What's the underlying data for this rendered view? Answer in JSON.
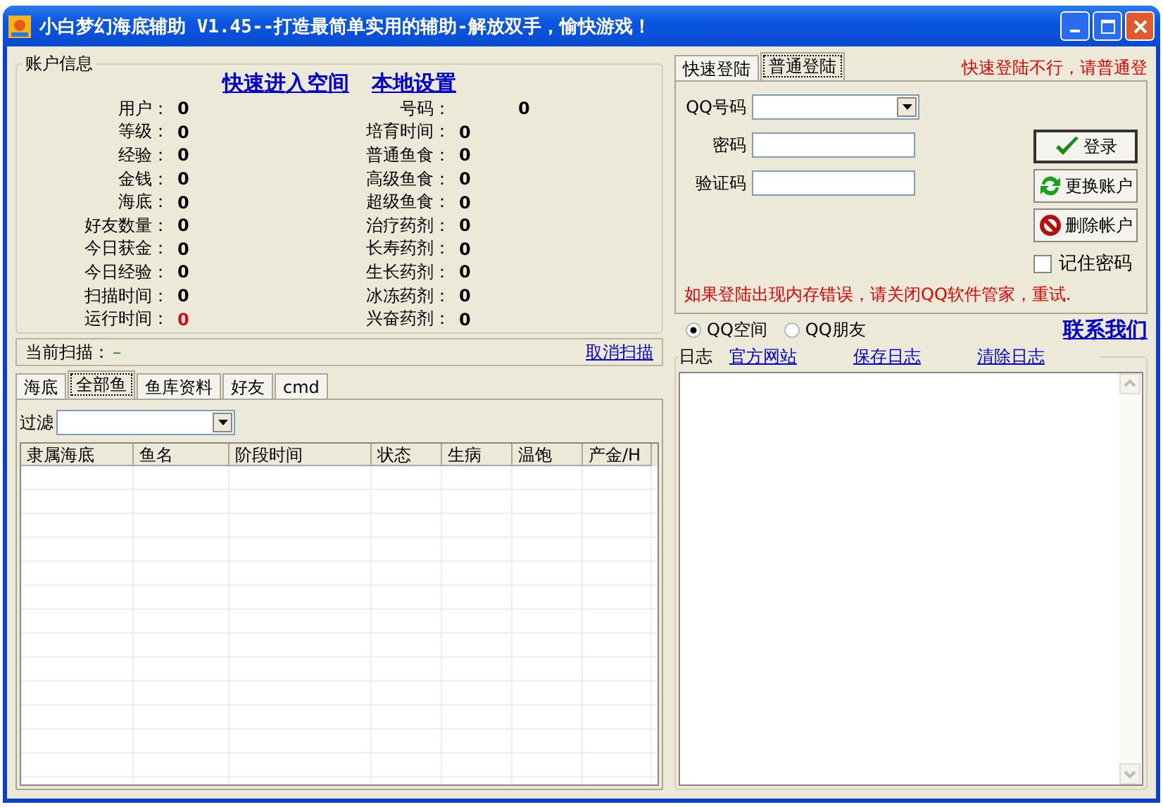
{
  "window": {
    "title": "小白梦幻海底辅助 V1.45--打造最简单实用的辅助-解放双手，愉快游戏！"
  },
  "account": {
    "title": "账户信息",
    "links": [
      "快速进入空间",
      "本地设置"
    ],
    "left_stats": [
      {
        "label": "用户：",
        "value": "0",
        "alert": false
      },
      {
        "label": "等级：",
        "value": "0",
        "alert": false
      },
      {
        "label": "经验：",
        "value": "0",
        "alert": false
      },
      {
        "label": "金钱：",
        "value": "0",
        "alert": false
      },
      {
        "label": "海底：",
        "value": "0",
        "alert": false
      },
      {
        "label": "好友数量：",
        "value": "0",
        "alert": false
      },
      {
        "label": "今日获金：",
        "value": "0",
        "alert": false
      },
      {
        "label": "今日经验：",
        "value": "0",
        "alert": false
      },
      {
        "label": "扫描时间：",
        "value": "0",
        "alert": false
      },
      {
        "label": "运行时间：",
        "value": "0",
        "alert": true
      }
    ],
    "right_stats": [
      {
        "label": "号码：",
        "value": "0",
        "kind": "wide"
      },
      {
        "label": "培育时间：",
        "value": "0",
        "kind": "normal"
      },
      {
        "label": "普通鱼食：",
        "value": "0",
        "kind": "normal"
      },
      {
        "label": "高级鱼食：",
        "value": "0",
        "kind": "normal"
      },
      {
        "label": "超级鱼食：",
        "value": "0",
        "kind": "normal"
      },
      {
        "label": "治疗药剂：",
        "value": "0",
        "kind": "normal"
      },
      {
        "label": "长寿药剂：",
        "value": "0",
        "kind": "normal"
      },
      {
        "label": "生长药剂：",
        "value": "0",
        "kind": "normal"
      },
      {
        "label": "冰冻药剂：",
        "value": "0",
        "kind": "normal"
      },
      {
        "label": "兴奋药剂：",
        "value": "0",
        "kind": "normal"
      }
    ]
  },
  "scan": {
    "label": "当前扫描：",
    "value": "–",
    "cancel": "取消扫描"
  },
  "fish_tabs": [
    {
      "label": "海底",
      "selected": false
    },
    {
      "label": "全部鱼",
      "selected": true
    },
    {
      "label": "鱼库资料",
      "selected": false
    },
    {
      "label": "好友",
      "selected": false
    },
    {
      "label": "cmd",
      "selected": false
    }
  ],
  "filter": {
    "label": "过滤"
  },
  "table": {
    "columns": [
      "隶属海底",
      "鱼名",
      "阶段时间",
      "状态",
      "生病",
      "温饱",
      "产金/H"
    ]
  },
  "login_tabs": [
    {
      "label": "快速登陆",
      "selected": false
    },
    {
      "label": "普通登陆",
      "selected": true
    }
  ],
  "login_notice": "快速登陆不行，请普通登",
  "fields": [
    {
      "label": "QQ号码",
      "kind": "combo"
    },
    {
      "label": "密码",
      "kind": "text"
    },
    {
      "label": "验证码",
      "kind": "text"
    }
  ],
  "buttons": [
    {
      "label": "登录",
      "kind": "login"
    },
    {
      "label": "更换账户",
      "kind": "switch"
    },
    {
      "label": "删除帐户",
      "kind": "delete"
    }
  ],
  "remember": {
    "label": "记住密码",
    "checked": false
  },
  "error_note": "如果登陆出现内存错误，请关闭QQ软件管家，重试.",
  "radios": [
    {
      "label": "QQ空间",
      "selected": true
    },
    {
      "label": "QQ朋友",
      "selected": false
    }
  ],
  "contact": "联系我们",
  "log": {
    "title": "日志",
    "links": [
      "官方网站",
      "保存日志",
      "清除日志"
    ]
  }
}
